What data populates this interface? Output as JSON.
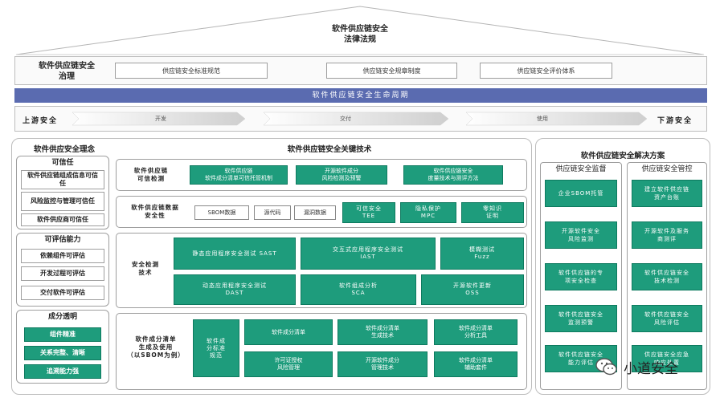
{
  "law": {
    "line1": "软件供应链安全",
    "line2": "法律法规"
  },
  "governance": {
    "label_line1": "软件供应链安全",
    "label_line2": "治理",
    "items": [
      "供应链安全标准规范",
      "供应链安全规章制度",
      "供应链安全评价体系"
    ]
  },
  "lifecycle": {
    "title": "软件供应链安全生命周期"
  },
  "flow": {
    "upstream": "上游安全",
    "downstream": "下游安全",
    "stages": [
      "开发",
      "交付",
      "使用"
    ]
  },
  "concept": {
    "title": "软件供应安全理念",
    "trust": {
      "title": "可信任",
      "items": [
        "软件供应链组成信息可信任",
        "风险监控与管理可信任",
        "软件供应商可信任"
      ]
    },
    "assess": {
      "title": "可评估能力",
      "items": [
        "依赖组件可评估",
        "开发过程可评估",
        "交付软件可评估"
      ]
    },
    "transparent": {
      "title": "成分透明",
      "items": [
        "组件精准",
        "关系完整、清晰",
        "追溯能力强"
      ]
    }
  },
  "tech": {
    "title": "软件供应链安全关键技术",
    "row1": {
      "label_line1": "软件供应链",
      "label_line2": "可信检测",
      "items": [
        {
          "l1": "软件供应链",
          "l2": "软件成分清单可信托管机制"
        },
        {
          "l1": "开源软件成分",
          "l2": "风险检测及预警"
        },
        {
          "l1": "软件供应链安全",
          "l2": "度量技术与测评方法"
        }
      ]
    },
    "row2": {
      "label_line1": "软件供应链数据",
      "label_line2": "安全性",
      "white": [
        "SBOM数据",
        "源代码",
        "漏洞数据"
      ],
      "green": [
        {
          "l1": "可信安全",
          "l2": "TEE"
        },
        {
          "l1": "隐私保护",
          "l2": "MPC"
        },
        {
          "l1": "零知识",
          "l2": "证明"
        }
      ]
    },
    "row3": {
      "label_line1": "安全检测",
      "label_line2": "技术",
      "items": [
        {
          "l1": "静态应用程序安全测试 SAST",
          "l2": ""
        },
        {
          "l1": "交互式应用程序安全测试",
          "l2": "IAST"
        },
        {
          "l1": "模糊测试",
          "l2": "Fuzz"
        },
        {
          "l1": "动态应用程序安全测试",
          "l2": "DAST"
        },
        {
          "l1": "软件组成分析",
          "l2": "SCA"
        },
        {
          "l1": "开源软件更新",
          "l2": "OSS"
        }
      ]
    },
    "row4": {
      "label_line1": "软件成分清单",
      "label_line2": "生成及使用",
      "label_line3": "（以SBOM为例）",
      "big": {
        "l1": "软件成",
        "l2": "分标准",
        "l3": "规范"
      },
      "items": [
        {
          "l1": "软件成分清单",
          "l2": ""
        },
        {
          "l1": "软件成分清单",
          "l2": "生成技术"
        },
        {
          "l1": "软件成分清单",
          "l2": "分析工具"
        },
        {
          "l1": "许可证授权",
          "l2": "风险管理"
        },
        {
          "l1": "开源软件成分",
          "l2": "管理技术"
        },
        {
          "l1": "软件成分清单",
          "l2": "辅助套件"
        }
      ]
    }
  },
  "solution": {
    "title": "软件供应链安全解决方案",
    "monitor": {
      "title": "供应链安全监督",
      "items": [
        {
          "l1": "企业SBOM托管",
          "l2": ""
        },
        {
          "l1": "开源软件安全",
          "l2": "风险监测"
        },
        {
          "l1": "软件供应链的专",
          "l2": "项安全检查"
        },
        {
          "l1": "软件供应链安全",
          "l2": "监测预警"
        },
        {
          "l1": "软件供应链安全",
          "l2": "能力评估"
        }
      ]
    },
    "control": {
      "title": "供应链安全管控",
      "items": [
        {
          "l1": "建立软件供应链",
          "l2": "资产台账"
        },
        {
          "l1": "开源软件及服务",
          "l2": "商测评"
        },
        {
          "l1": "软件供应链安全",
          "l2": "技术检测"
        },
        {
          "l1": "软件供应链安全",
          "l2": "风险评估"
        },
        {
          "l1": "供应链安全应急",
          "l2": "响应处置"
        }
      ]
    }
  },
  "watermark": {
    "text": "小道安全"
  }
}
